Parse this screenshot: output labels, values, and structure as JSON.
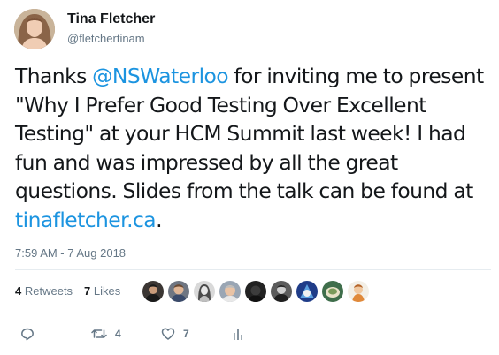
{
  "author": {
    "name": "Tina Fletcher",
    "handle": "@fletchertinam",
    "avatar_icon": "user-avatar"
  },
  "tweet": {
    "text_before": "Thanks ",
    "mention": "@NSWaterloo",
    "text_middle": " for inviting me to present \"Why I Prefer Good Testing Over Excellent Testing\" at your HCM Summit last week! I had fun and was impressed by all the great questions. Slides from the talk can be found at ",
    "link": "tinafletcher.ca",
    "text_after": ".",
    "timestamp": "7:59 AM - 7 Aug 2018"
  },
  "stats": {
    "retweets_count": "4",
    "retweets_label": "Retweets",
    "likes_count": "7",
    "likes_label": "Likes"
  },
  "likers": [
    {
      "icon": "liker-avatar"
    },
    {
      "icon": "liker-avatar"
    },
    {
      "icon": "liker-avatar"
    },
    {
      "icon": "liker-avatar"
    },
    {
      "icon": "liker-avatar"
    },
    {
      "icon": "liker-avatar"
    },
    {
      "icon": "liker-avatar"
    },
    {
      "icon": "liker-avatar"
    },
    {
      "icon": "liker-avatar"
    }
  ],
  "actions": {
    "reply_icon": "reply-icon",
    "retweet_icon": "retweet-icon",
    "retweet_count": "4",
    "like_icon": "heart-icon",
    "like_count": "7",
    "analytics_icon": "analytics-icon"
  },
  "colors": {
    "link": "#1c94e0",
    "text": "#14171a",
    "muted": "#657786",
    "divider": "#e6ecf0"
  }
}
